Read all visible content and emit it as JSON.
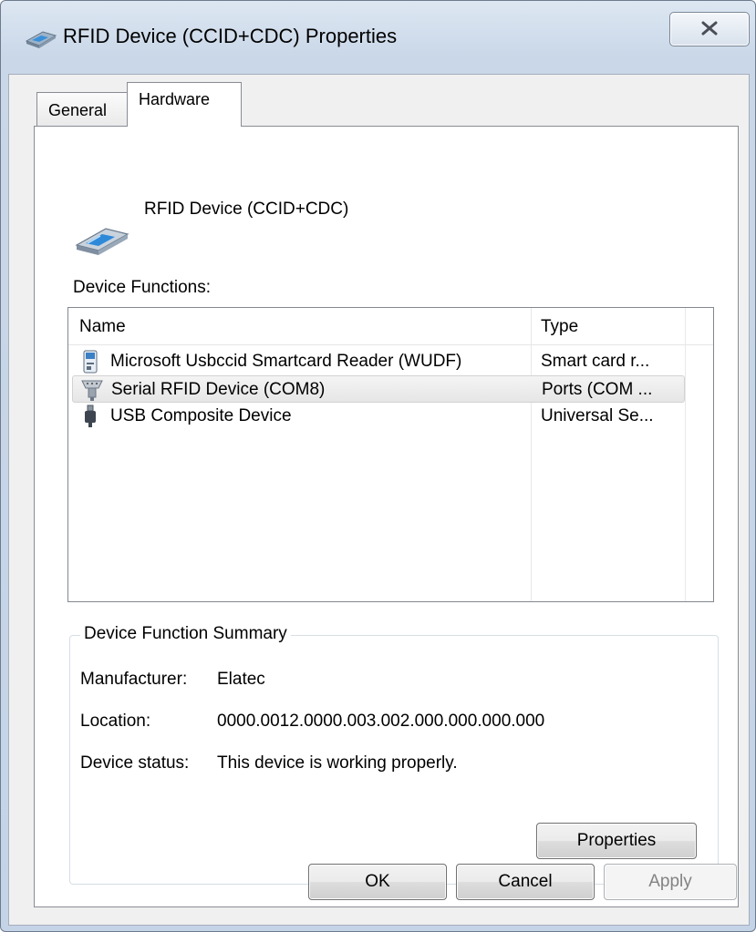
{
  "window": {
    "title": "RFID Device (CCID+CDC) Properties"
  },
  "tabs": [
    {
      "label": "General"
    },
    {
      "label": "Hardware"
    }
  ],
  "hardware": {
    "device_name": "RFID Device (CCID+CDC)",
    "functions_label": "Device Functions:",
    "columns": {
      "name": "Name",
      "type": "Type"
    },
    "rows": [
      {
        "name": "Microsoft Usbccid Smartcard Reader (WUDF)",
        "type": "Smart card r...",
        "icon": "smartcard-reader-icon"
      },
      {
        "name": "Serial RFID Device (COM8)",
        "type": "Ports (COM ...",
        "icon": "serial-port-icon"
      },
      {
        "name": "USB Composite Device",
        "type": "Universal Se...",
        "icon": "usb-plug-icon"
      }
    ],
    "summary": {
      "legend": "Device Function Summary",
      "manufacturer_label": "Manufacturer:",
      "manufacturer_value": "Elatec",
      "location_label": "Location:",
      "location_value": "0000.0012.0000.003.002.000.000.000.000",
      "status_label": "Device status:",
      "status_value": "This device is working properly.",
      "properties_button": "Properties"
    }
  },
  "buttons": {
    "ok": "OK",
    "cancel": "Cancel",
    "apply": "Apply"
  }
}
